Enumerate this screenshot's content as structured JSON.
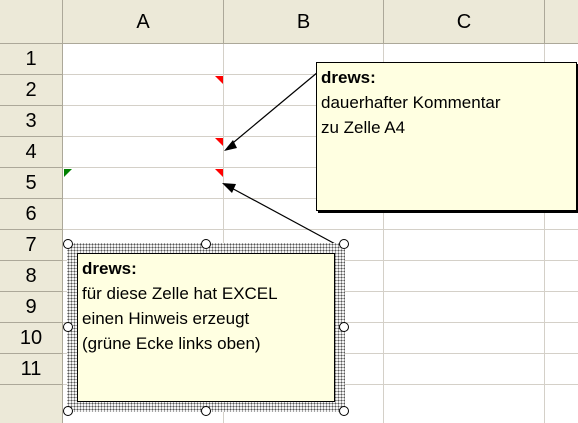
{
  "columns": [
    "A",
    "B",
    "C"
  ],
  "rows": [
    "1",
    "2",
    "3",
    "4",
    "5",
    "6",
    "7",
    "8",
    "9",
    "10",
    "11"
  ],
  "notes": {
    "permanent": {
      "author": "drews:",
      "lines": [
        "dauerhafter Kommentar",
        "zu Zelle A4"
      ]
    },
    "hint": {
      "author": "drews:",
      "lines": [
        "für diese Zelle hat EXCEL",
        "einen Hinweis erzeugt",
        "(grüne Ecke links oben)"
      ]
    }
  },
  "colors": {
    "comment_indicator": "#ff0000",
    "error_indicator": "#008000",
    "note_background": "#ffffe1",
    "header_background": "#ece9d8"
  }
}
